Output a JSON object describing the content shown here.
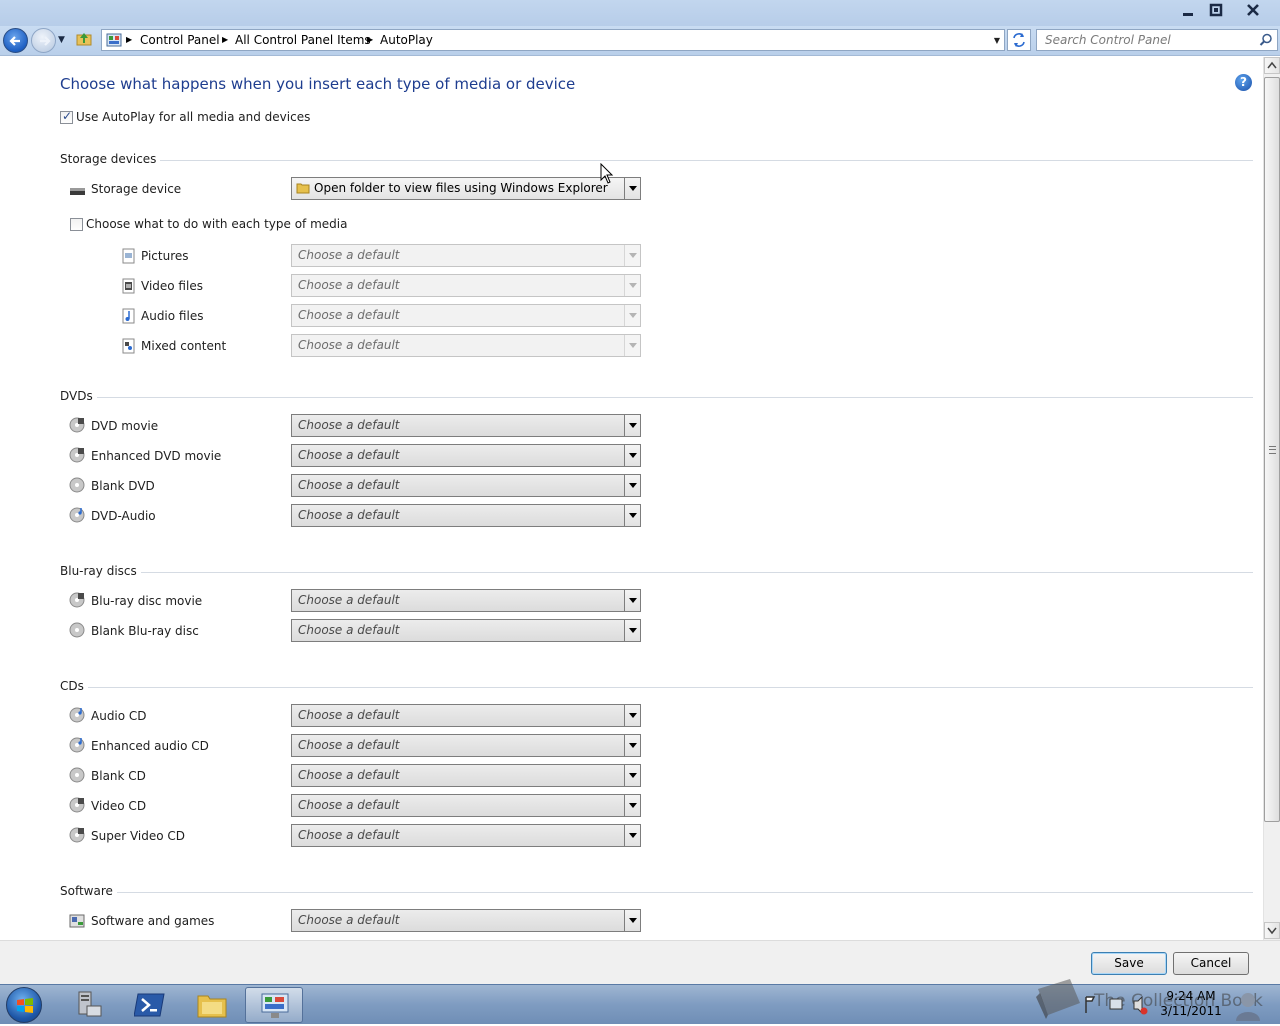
{
  "address_bar": {
    "crumbs": [
      "Control Panel",
      "All Control Panel Items",
      "AutoPlay"
    ],
    "search_placeholder": "Search Control Panel"
  },
  "page": {
    "heading": "Choose what happens when you insert each type of media or device",
    "use_autoplay_label": "Use AutoPlay for all media and devices",
    "use_autoplay_checked": true
  },
  "default_choice": "Choose a default",
  "storage": {
    "title": "Storage devices",
    "device_label": "Storage device",
    "device_value": "Open folder to view files using Windows Explorer",
    "choose_each_label": "Choose what to do with each type of media",
    "choose_each_checked": false,
    "media": [
      {
        "label": "Pictures",
        "value": "Choose a default"
      },
      {
        "label": "Video files",
        "value": "Choose a default"
      },
      {
        "label": "Audio files",
        "value": "Choose a default"
      },
      {
        "label": "Mixed content",
        "value": "Choose a default"
      }
    ]
  },
  "dvds": {
    "title": "DVDs",
    "items": [
      {
        "label": "DVD movie",
        "value": "Choose a default"
      },
      {
        "label": "Enhanced DVD movie",
        "value": "Choose a default"
      },
      {
        "label": "Blank DVD",
        "value": "Choose a default"
      },
      {
        "label": "DVD-Audio",
        "value": "Choose a default"
      }
    ]
  },
  "bluray": {
    "title": "Blu-ray discs",
    "items": [
      {
        "label": "Blu-ray disc movie",
        "value": "Choose a default"
      },
      {
        "label": "Blank Blu-ray disc",
        "value": "Choose a default"
      }
    ]
  },
  "cds": {
    "title": "CDs",
    "items": [
      {
        "label": "Audio CD",
        "value": "Choose a default"
      },
      {
        "label": "Enhanced audio CD",
        "value": "Choose a default"
      },
      {
        "label": "Blank CD",
        "value": "Choose a default"
      },
      {
        "label": "Video CD",
        "value": "Choose a default"
      },
      {
        "label": "Super Video CD",
        "value": "Choose a default"
      }
    ]
  },
  "software": {
    "title": "Software",
    "items": [
      {
        "label": "Software and games",
        "value": "Choose a default"
      }
    ]
  },
  "buttons": {
    "save": "Save",
    "cancel": "Cancel"
  },
  "taskbar": {
    "clock_time": "9:24 AM",
    "clock_date": "3/11/2011",
    "watermark": "The Collection Book"
  },
  "colors": {
    "heading": "#1e3d8f",
    "taskbar": "#7f9cc1"
  }
}
